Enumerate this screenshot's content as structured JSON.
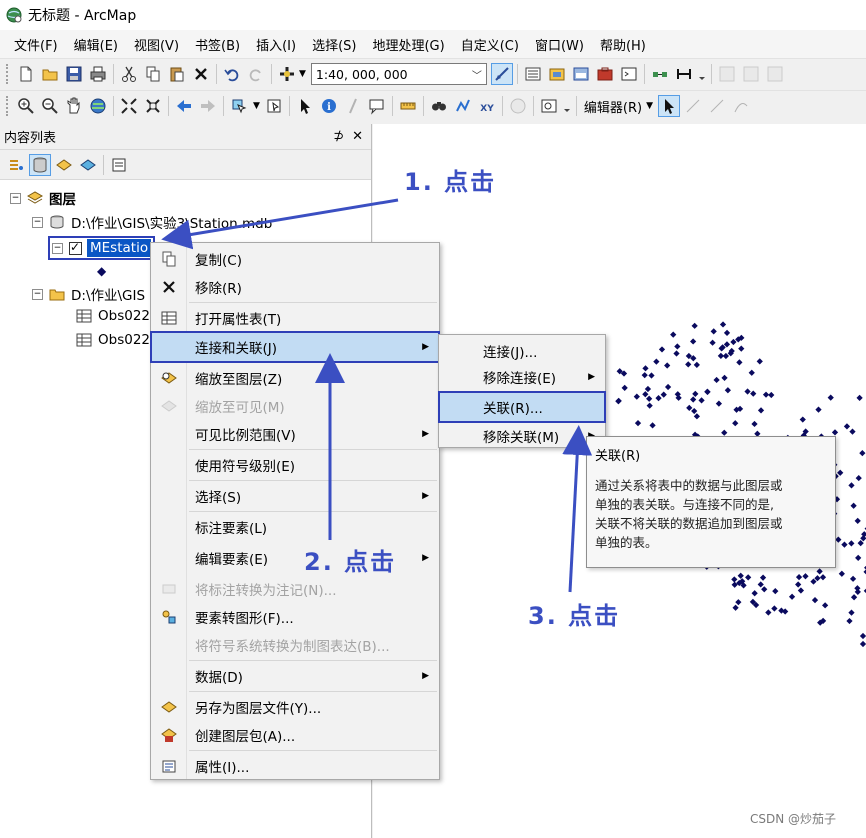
{
  "window": {
    "title": "无标题 - ArcMap"
  },
  "menubar": [
    "文件(F)",
    "编辑(E)",
    "视图(V)",
    "书签(B)",
    "插入(I)",
    "选择(S)",
    "地理处理(G)",
    "自定义(C)",
    "窗口(W)",
    "帮助(H)"
  ],
  "toolbar": {
    "scale": "1:40, 000, 000",
    "editor_label": "编辑器(R)"
  },
  "toc": {
    "title": "内容列表",
    "pin": "⊅",
    "close": "✕",
    "tree": {
      "root": "图层",
      "db1": "D:\\作业\\GIS\\实验3\\Station.mdb",
      "layer": "MEstatio",
      "db2": "D:\\作业\\GIS",
      "table1": "Obs022",
      "table2": "Obs022"
    }
  },
  "context_menu": {
    "items": [
      {
        "label": "复制(C)"
      },
      {
        "label": "移除(R)"
      },
      {
        "label": "打开属性表(T)"
      },
      {
        "label": "连接和关联(J)"
      },
      {
        "label": "缩放至图层(Z)"
      },
      {
        "label": "缩放至可见(M)"
      },
      {
        "label": "可见比例范围(V)"
      },
      {
        "label": "使用符号级别(E)"
      },
      {
        "label": "选择(S)"
      },
      {
        "label": "标注要素(L)"
      },
      {
        "label": "编辑要素(E)"
      },
      {
        "label": "将标注转换为注记(N)..."
      },
      {
        "label": "要素转图形(F)..."
      },
      {
        "label": "将符号系统转换为制图表达(B)..."
      },
      {
        "label": "数据(D)"
      },
      {
        "label": "另存为图层文件(Y)..."
      },
      {
        "label": "创建图层包(A)..."
      },
      {
        "label": "属性(I)..."
      }
    ]
  },
  "submenu": {
    "items": [
      {
        "label": "连接(J)..."
      },
      {
        "label": "移除连接(E)"
      },
      {
        "label": "关联(R)..."
      },
      {
        "label": "移除关联(M)"
      }
    ]
  },
  "tooltip": {
    "title": "关联(R)",
    "line1": "通过关系将表中的数据与此图层或",
    "line2": "单独的表关联。与连接不同的是,",
    "line3": "关联不将关联的数据追加到图层或",
    "line4": "单独的表。"
  },
  "annotations": {
    "step1": "1. 点击",
    "step2": "2. 点击",
    "step3": "3. 点击"
  },
  "watermark": "CSDN @炒茄子",
  "colors": {
    "annotation": "#3b4fc2",
    "highlight": "#c2dcf3",
    "selection": "#0a56c5",
    "points": "#0a0a5e"
  },
  "icons": [
    "globe-icon",
    "new-doc-icon",
    "open-folder-icon",
    "save-icon",
    "print-icon",
    "cut-icon",
    "copy-icon",
    "paste-icon",
    "delete-icon",
    "undo-icon",
    "redo-icon",
    "add-data-icon",
    "zoom-in-icon",
    "zoom-out-icon",
    "pan-icon",
    "full-extent-icon",
    "identify-icon",
    "find-icon",
    "select-arrow-icon",
    "layers-icon",
    "folder-icon",
    "database-icon",
    "table-icon",
    "copy-menu-icon",
    "remove-x-icon",
    "zoom-layer-icon",
    "properties-icon"
  ]
}
